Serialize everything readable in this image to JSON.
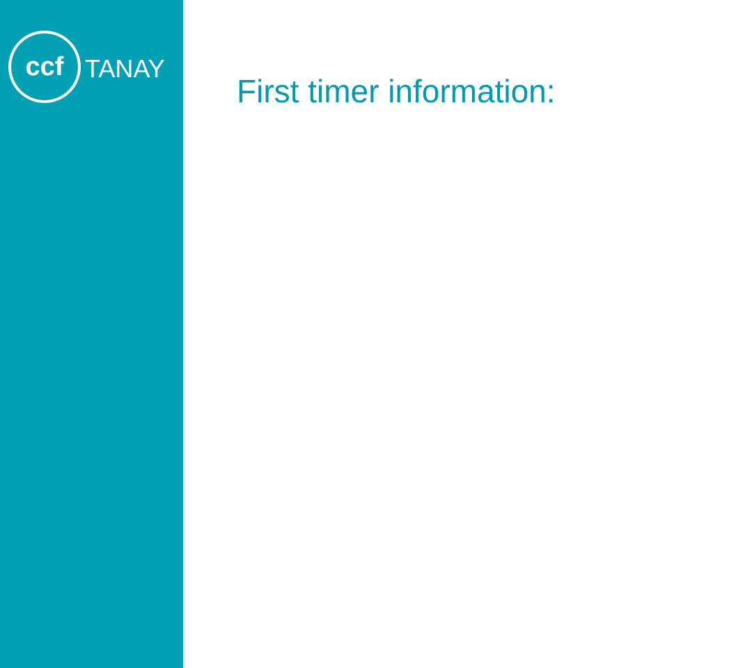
{
  "brand": {
    "logo_mark": "ccf",
    "logo_text": "TANAY",
    "sidebar_color": "#00a0b4",
    "logo_color": "#ffffff"
  },
  "slide": {
    "title": "First timer information:",
    "title_color": "#0099ad",
    "background": "#ffffff"
  }
}
